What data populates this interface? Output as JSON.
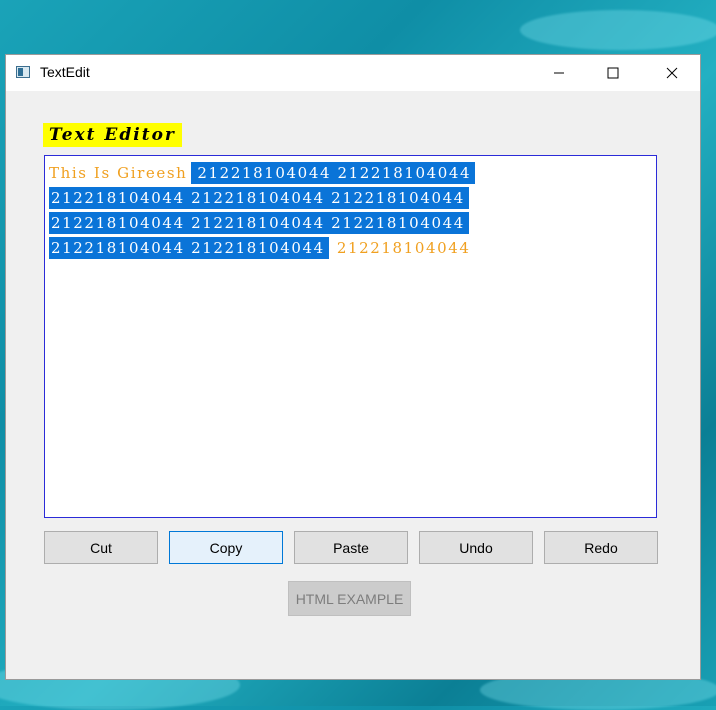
{
  "window": {
    "title": "TextEdit"
  },
  "heading": {
    "label": "Text Editor"
  },
  "editor": {
    "line1": {
      "plain": "This Is Gireesh",
      "selected": "212218104044 212218104044"
    },
    "line2": {
      "selected": "212218104044 212218104044 212218104044"
    },
    "line3": {
      "selected": "212218104044 212218104044 212218104044"
    },
    "line4": {
      "selected": "212218104044 212218104044",
      "plain": "212218104044"
    }
  },
  "buttons": {
    "cut": "Cut",
    "copy": "Copy",
    "paste": "Paste",
    "undo": "Undo",
    "redo": "Redo",
    "html_example": "HTML EXAMPLE"
  },
  "colors": {
    "heading_background": "#ffff00",
    "plain_text": "#f0a020",
    "selection": "#0a74d8",
    "editor_border": "#2b2bd8"
  }
}
